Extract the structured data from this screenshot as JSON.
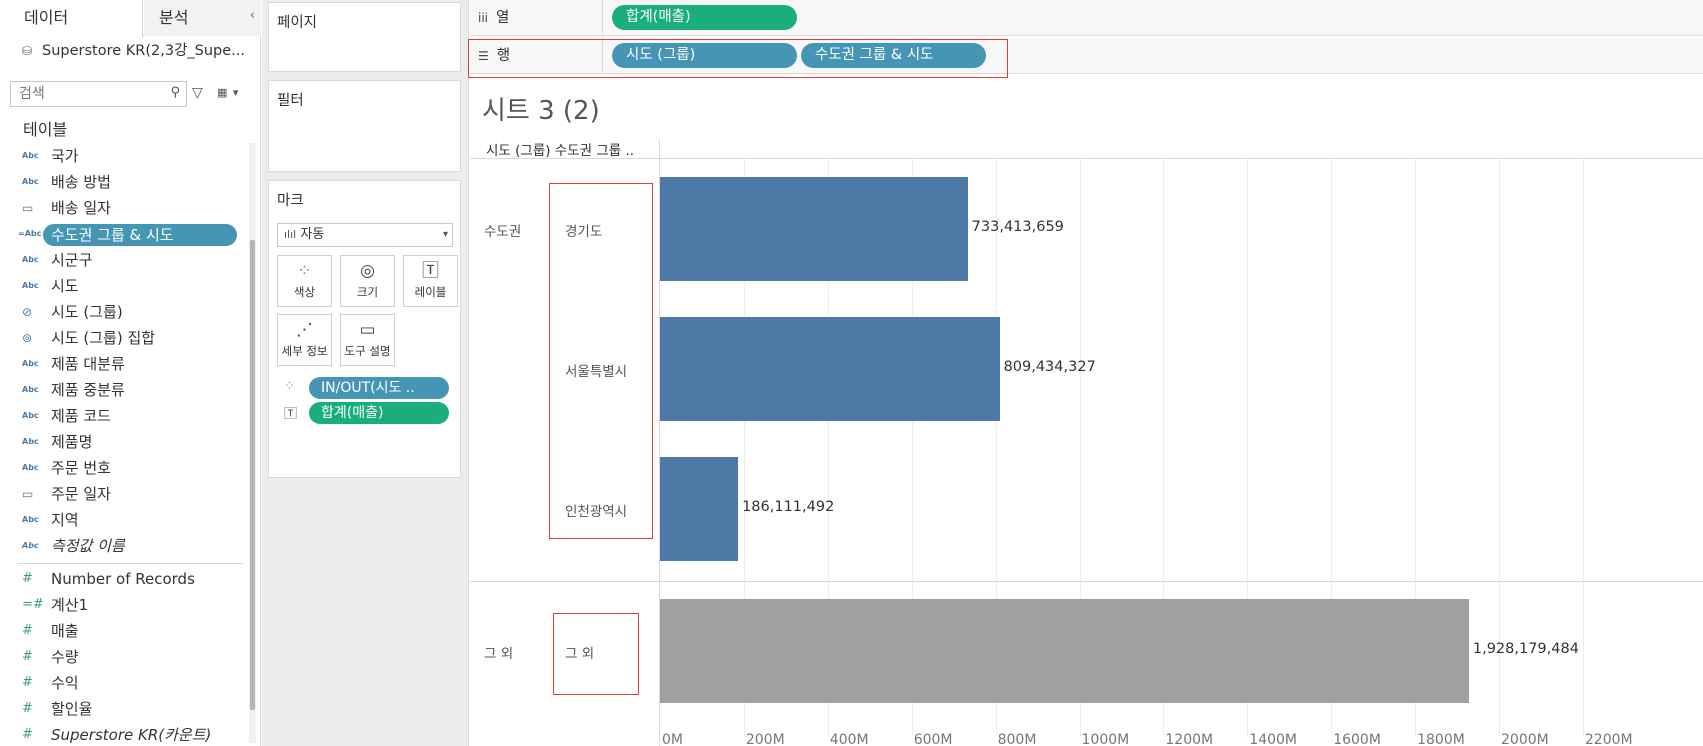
{
  "data_pane": {
    "tabs": [
      "데이터",
      "분석"
    ],
    "collapse_icon": "‹",
    "data_source": "Superstore KR(2,3강_Supe...",
    "search_placeholder": "검색",
    "section_title": "테이블",
    "dimensions": [
      {
        "type": "Abc",
        "name": "국가"
      },
      {
        "type": "Abc",
        "name": "배송 방법"
      },
      {
        "type": "date",
        "name": "배송 일자"
      },
      {
        "type": "Abc",
        "name": "수도권 그룹 & 시도",
        "selected": true
      },
      {
        "type": "Abc",
        "name": "시군구"
      },
      {
        "type": "Abc",
        "name": "시도"
      },
      {
        "type": "group",
        "name": "시도 (그룹)"
      },
      {
        "type": "set",
        "name": "시도 (그룹) 집합"
      },
      {
        "type": "Abc",
        "name": "제품 대분류"
      },
      {
        "type": "Abc",
        "name": "제품 중분류"
      },
      {
        "type": "Abc",
        "name": "제품 코드"
      },
      {
        "type": "Abc",
        "name": "제품명"
      },
      {
        "type": "Abc",
        "name": "주문 번호"
      },
      {
        "type": "date",
        "name": "주문 일자"
      },
      {
        "type": "Abc",
        "name": "지역"
      },
      {
        "type": "Abc",
        "name": "측정값 이름",
        "italic": true
      }
    ],
    "measures": [
      {
        "type": "#",
        "name": "Number of Records"
      },
      {
        "type": "#",
        "name": "계산1"
      },
      {
        "type": "#",
        "name": "매출"
      },
      {
        "type": "#",
        "name": "수량"
      },
      {
        "type": "#",
        "name": "수익"
      },
      {
        "type": "#",
        "name": "할인율"
      },
      {
        "type": "#",
        "name": "Superstore KR(카운트)",
        "italic": true
      }
    ]
  },
  "cards": {
    "pages": "페이지",
    "filters": "필터",
    "marks": {
      "title": "마크",
      "mark_type": "자동",
      "buttons": [
        "색상",
        "크기",
        "레이블",
        "세부 정보",
        "도구 설명"
      ],
      "pills": [
        {
          "icon": "color",
          "label": "IN/OUT(시도 .."
        },
        {
          "icon": "label",
          "label": "합계(매출)"
        }
      ]
    }
  },
  "shelves": {
    "columns_label": "열",
    "columns_pills": [
      "합계(매출)"
    ],
    "rows_label": "행",
    "rows_pills": [
      "시도 (그룹)",
      "수도권 그룹 & 시도"
    ]
  },
  "sheet": {
    "title": "시트 3 (2)",
    "header_text": "시도 (그룹) 수도권 그룹 .."
  },
  "chart_data": {
    "type": "bar",
    "orientation": "horizontal",
    "groups": [
      {
        "name": "수도권",
        "categories": [
          "경기도",
          "서울특별시",
          "인천광역시"
        ],
        "values": [
          733413659,
          809434327,
          186111492
        ],
        "color": "#4e79a7"
      },
      {
        "name": "그 외",
        "categories": [
          "그 외"
        ],
        "values": [
          1928179484
        ],
        "color": "#a0a0a0"
      }
    ],
    "value_labels": [
      "733,413,659",
      "809,434,327",
      "186,111,492",
      "1,928,179,484"
    ],
    "x_ticks": [
      "0M",
      "200M",
      "400M",
      "600M",
      "800M",
      "1000M",
      "1200M",
      "1400M",
      "1600M",
      "1800M",
      "2000M",
      "2200M"
    ],
    "xlim": [
      0,
      2200000000
    ],
    "grid": true
  }
}
